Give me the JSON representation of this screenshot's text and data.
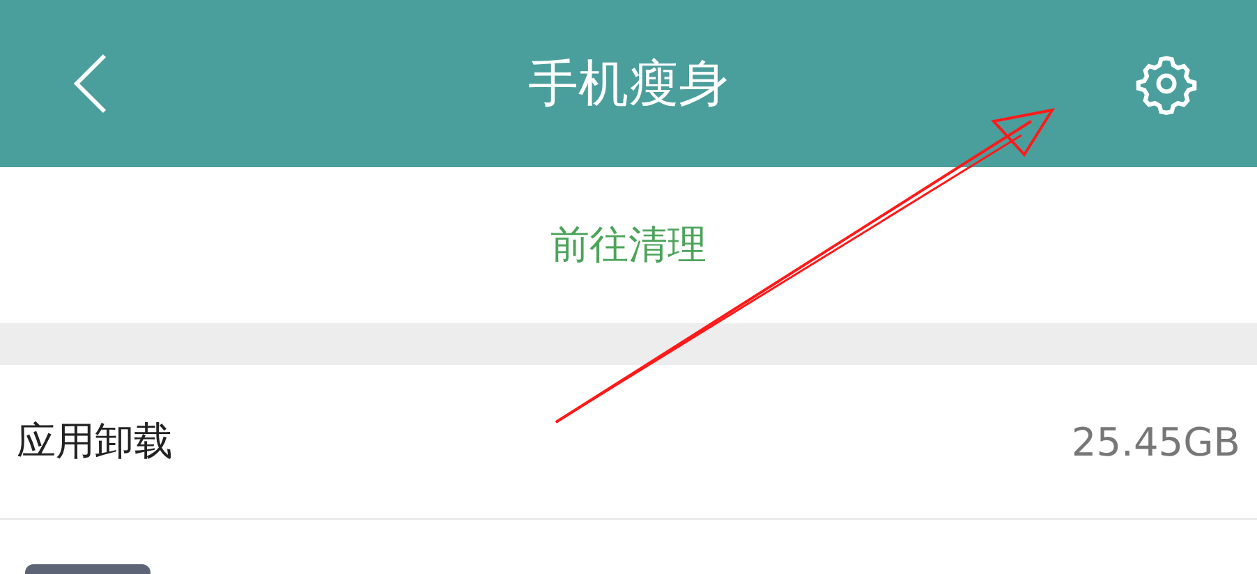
{
  "header": {
    "title": "手机瘦身"
  },
  "clean_link": "前往清理",
  "uninstall_row": {
    "label": "应用卸载",
    "size": "25.45GB"
  }
}
